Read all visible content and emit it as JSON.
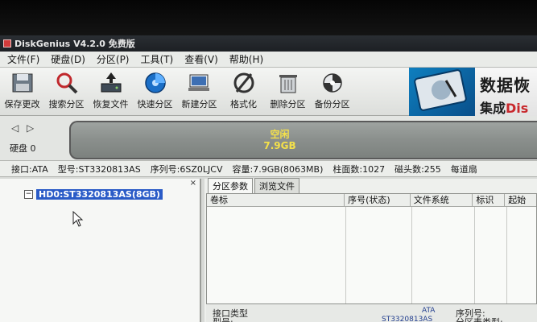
{
  "window": {
    "title": "DiskGenius V4.2.0 免费版"
  },
  "menu": [
    "文件(F)",
    "硬盘(D)",
    "分区(P)",
    "工具(T)",
    "查看(V)",
    "帮助(H)"
  ],
  "toolbar": [
    {
      "label": "保存更改",
      "icon": "save-icon"
    },
    {
      "label": "搜索分区",
      "icon": "search-icon"
    },
    {
      "label": "恢复文件",
      "icon": "restore-icon"
    },
    {
      "label": "快速分区",
      "icon": "quick-partition-icon"
    },
    {
      "label": "新建分区",
      "icon": "new-partition-icon"
    },
    {
      "label": "格式化",
      "icon": "format-icon"
    },
    {
      "label": "删除分区",
      "icon": "delete-icon"
    },
    {
      "label": "备份分区",
      "icon": "backup-icon"
    }
  ],
  "brand": {
    "line1": "数据恢",
    "line2_prefix": "集成",
    "line2_suffix": "Dis"
  },
  "diskbar": {
    "nav": "◁ ▷",
    "disk_label": "硬盘 0",
    "free_label": "空闲",
    "free_size": "7.9GB"
  },
  "disk_info": {
    "interface": "接口:ATA",
    "model": "型号:ST3320813AS",
    "serial": "序列号:6SZ0LJCV",
    "capacity": "容量:7.9GB(8063MB)",
    "cylinders": "柱面数:1027",
    "heads": "磁头数:255",
    "sectors": "每道扇"
  },
  "tree": {
    "close": "×",
    "disk_node": "HD0:ST3320813AS(8GB)"
  },
  "tabs": [
    "分区参数",
    "浏览文件"
  ],
  "grid_headers": [
    "卷标",
    "序号(状态)",
    "文件系统",
    "标识",
    "起始"
  ],
  "details": {
    "interface_label": "接口类型",
    "interface_value": "ATA",
    "serial_label": "序列号:",
    "model_label": "型号:",
    "model_value": "ST3320813AS",
    "table_type_label": "分区表类型:"
  },
  "colors": {
    "selection": "#2a5bc7",
    "free_text": "#f4e04a",
    "brand_accent": "#c8282c"
  }
}
